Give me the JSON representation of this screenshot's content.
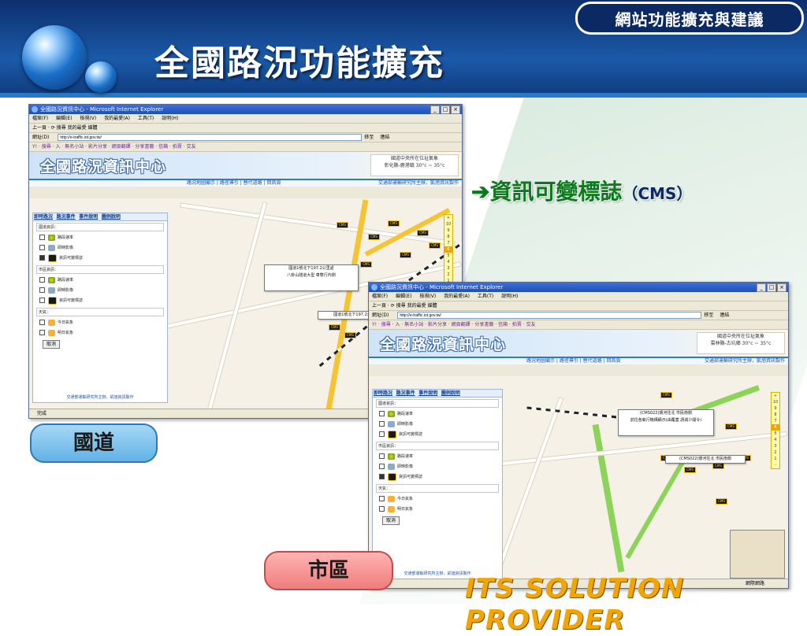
{
  "slide": {
    "title": "全國路況功能擴充",
    "badge": "網站功能擴充與建議",
    "label_highway": "國道",
    "label_urban": "市區",
    "cms_note_prefix": "➔資訊可變標誌",
    "cms_note_paren": "（CMS）",
    "brand": "ITS SOLUTION PROVIDER"
  },
  "browser1": {
    "window_title": "全國路況資訊中心 - Microsoft Internet Explorer",
    "menu": [
      "檔案(F)",
      "編輯(E)",
      "檢視(V)",
      "我的最愛(A)",
      "工具(T)",
      "說明(H)"
    ],
    "toolbar": "上一頁  ·  ⟳  搜尋  我的最愛  媒體",
    "address_label": "網址(D)",
    "address": "http://e-traffic.iot.gov.tw/",
    "go": "移至",
    "links": "連結",
    "yahoo_bar": "Y! · 搜尋 · 入 · 無名小站 · 影片分享 · 網頁翻譯 · 分享書籤 · 信箱 · 拍賣 · 交友",
    "site_title": "全國路況資訊中心",
    "info_line1": "國道中央所在位址氣象",
    "info_line2": "彰化縣-鹿港鎮 30°c ~ 35°c",
    "subnav": "路況地圖顯示 | 路徑導引 | 替代道路 | 回首頁",
    "subnav_right": "交通部運輸研究所主辦，凱旭資訊製作",
    "tabs": [
      "即時路況",
      "路況事件",
      "事件說明",
      "圖例說明"
    ],
    "group_highway": "國道資訊：",
    "group_urban": "市區資訊：",
    "group_weather": "天氣：",
    "opt_speed": "路段速率",
    "opt_video": "即時影像",
    "opt_cms": "資訊可變標誌",
    "opt_today": "今日氣象",
    "opt_tomorrow": "明日氣象",
    "cancel": "取消",
    "footer": "交通部運輸研究所主辦，凱旭資訊製作",
    "popup_line1": "國道1號北下197.2公里處",
    "popup_line2": "八卦山隧道大型 車雙行內側",
    "popup_line3": "國道1號北下197.2公里處",
    "scale": [
      "+",
      "10",
      "9",
      "8",
      "7",
      "6",
      "5",
      "4",
      "3",
      "2",
      "1",
      "-"
    ],
    "status": "完成"
  },
  "browser2": {
    "window_title": "全國路況資訊中心 - Microsoft Internet Explorer",
    "menu": [
      "檔案(F)",
      "編輯(E)",
      "檢視(V)",
      "我的最愛(A)",
      "工具(T)",
      "說明(H)"
    ],
    "toolbar": "上一頁  ·  ⟳  搜尋  我的最愛  媒體",
    "address_label": "網址(D)",
    "address": "http://e-traffic.iot.gov.tw/",
    "go": "移至",
    "links": "連結",
    "yahoo_bar": "Y! · 搜尋 · 入 · 無名小站 · 影片分享 · 網頁翻譯 · 分享書籤 · 信箱 · 拍賣 · 交友",
    "site_title": "全國路況資訊中心",
    "info_line1": "國道中央所在位址氣象",
    "info_line2": "雲林縣-古坑鄉 30°c ~ 35°c",
    "subnav": "路況地圖顯示 | 路徑導引 | 替代道路 | 回首頁",
    "subnav_right": "交通部運輸研究所主辦，凱旭資訊製作",
    "tabs": [
      "即時路況",
      "路況事件",
      "事件說明",
      "圖例說明"
    ],
    "group_highway": "國道資訊：",
    "group_urban": "市區資訊：",
    "group_weather": "天氣：",
    "opt_speed": "路段速率",
    "opt_video": "即時影像",
    "opt_cms": "資訊可變標誌",
    "opt_today": "今日氣象",
    "opt_tomorrow": "明日氣象",
    "cancel": "取消",
    "footer": "交通部運輸研究所主辦，凱旭資訊製作",
    "popup_line1": "(CMS022)環河往北  市民南側",
    "popup_line2": "前往各執行機構顯示(由覆蓋 請減少開令)",
    "popup_line3": "(CMS022)環河往北  市民南側",
    "scale": [
      "+",
      "10",
      "9",
      "8",
      "7",
      "6",
      "5",
      "4",
      "3",
      "2",
      "1",
      "-"
    ],
    "status": "完成",
    "status_right": "網際網路"
  },
  "colors": {
    "header_blue": "#1b5aa8",
    "title_white": "#ffffff",
    "cms_green": "#0b7a1c",
    "brand_orange": "#f0a500",
    "label_blue": "#62b2e6",
    "label_red": "#f07d7d"
  }
}
